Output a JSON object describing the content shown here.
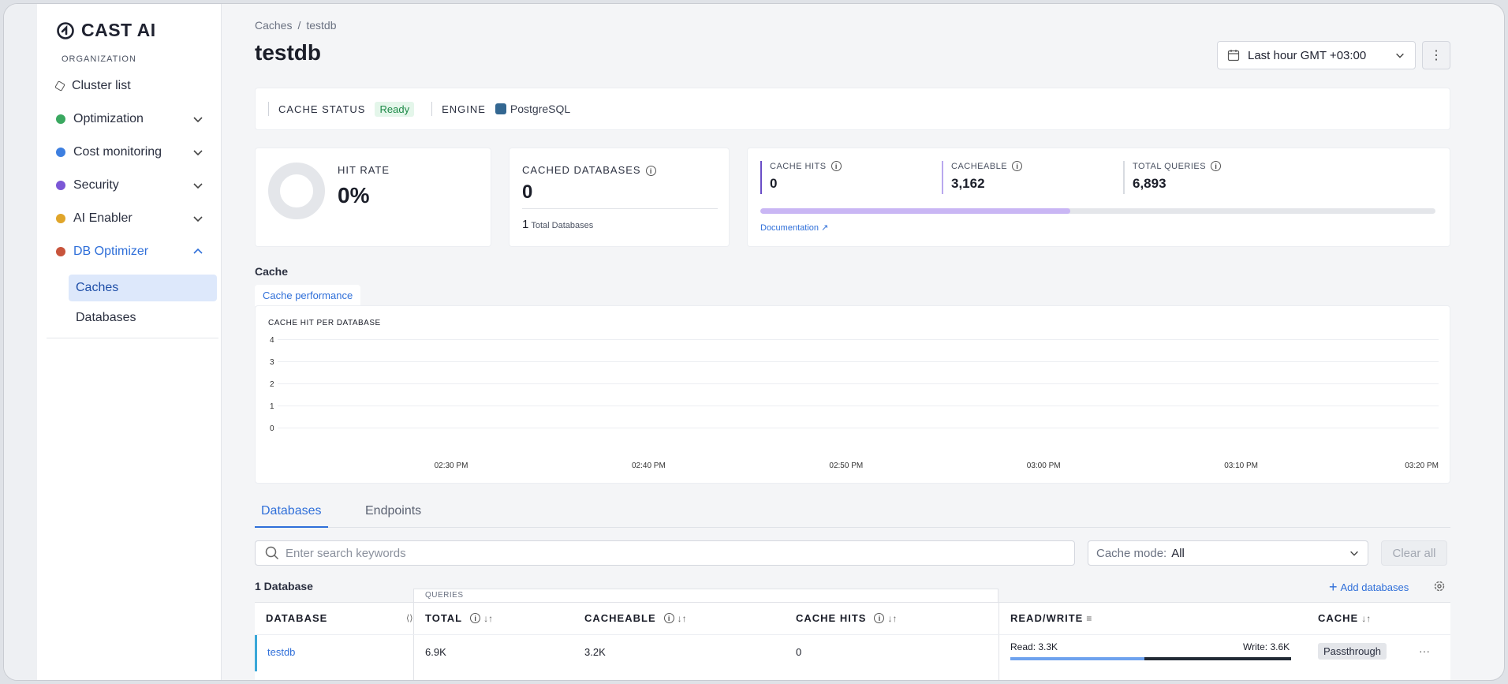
{
  "app": {
    "brand": "CAST AI",
    "org_label": "ORGANIZATION"
  },
  "sidebar": {
    "items": [
      {
        "label": "Cluster list",
        "icon": "hexagon-icon"
      },
      {
        "label": "Optimization",
        "icon": "optimization-icon"
      },
      {
        "label": "Cost monitoring",
        "icon": "cost-icon"
      },
      {
        "label": "Security",
        "icon": "shield-icon"
      },
      {
        "label": "AI Enabler",
        "icon": "ai-icon"
      },
      {
        "label": "DB Optimizer",
        "icon": "db-icon"
      }
    ],
    "subitems": [
      {
        "label": "Caches"
      },
      {
        "label": "Databases"
      }
    ]
  },
  "header": {
    "breadcrumb": [
      "Caches",
      "testdb"
    ],
    "title": "testdb",
    "time_range": "Last hour GMT +03:00"
  },
  "status": {
    "cache_status_label": "CACHE STATUS",
    "cache_status_value": "Ready",
    "engine_label": "ENGINE",
    "engine_value": "PostgreSQL"
  },
  "hit_rate": {
    "label": "HIT RATE",
    "value": "0%"
  },
  "cached_databases": {
    "label": "CACHED DATABASES",
    "value": "0",
    "total_count": "1",
    "total_label": "Total Databases"
  },
  "query_stats": {
    "cache_hits_label": "CACHE HITS",
    "cache_hits": "0",
    "cacheable_label": "CACHEABLE",
    "cacheable": "3,162",
    "total_queries_label": "TOTAL QUERIES",
    "total_queries": "6,893",
    "cacheable_fraction": 0.459,
    "doc_link": "Documentation"
  },
  "chart_section": {
    "title": "Cache",
    "tab": "Cache performance"
  },
  "chart_data": {
    "type": "line",
    "title": "CACHE HIT PER DATABASE",
    "y_ticks": [
      "0",
      "1",
      "2",
      "3",
      "4"
    ],
    "ylim": [
      0,
      4
    ],
    "x_ticks": [
      "02:30 PM",
      "02:40 PM",
      "02:50 PM",
      "03:00 PM",
      "03:10 PM",
      "03:20 PM"
    ],
    "series": [],
    "grid": true
  },
  "tabs": [
    {
      "label": "Databases"
    },
    {
      "label": "Endpoints"
    }
  ],
  "filters": {
    "search_placeholder": "Enter search keywords",
    "cache_mode_label": "Cache mode:",
    "cache_mode_value": "All",
    "clear_all": "Clear all"
  },
  "table": {
    "count_label": "1 Database",
    "add_label": "Add databases",
    "group_label": "QUERIES",
    "columns": [
      "DATABASE",
      "TOTAL",
      "CACHEABLE",
      "CACHE HITS",
      "READ/WRITE",
      "CACHE"
    ],
    "rows": [
      {
        "database": "testdb",
        "total": "6.9K",
        "cacheable": "3.2K",
        "cache_hits": "0",
        "read": "Read: 3.3K",
        "write": "Write: 3.6K",
        "read_fraction": 0.478,
        "cache": "Passthrough"
      }
    ]
  }
}
